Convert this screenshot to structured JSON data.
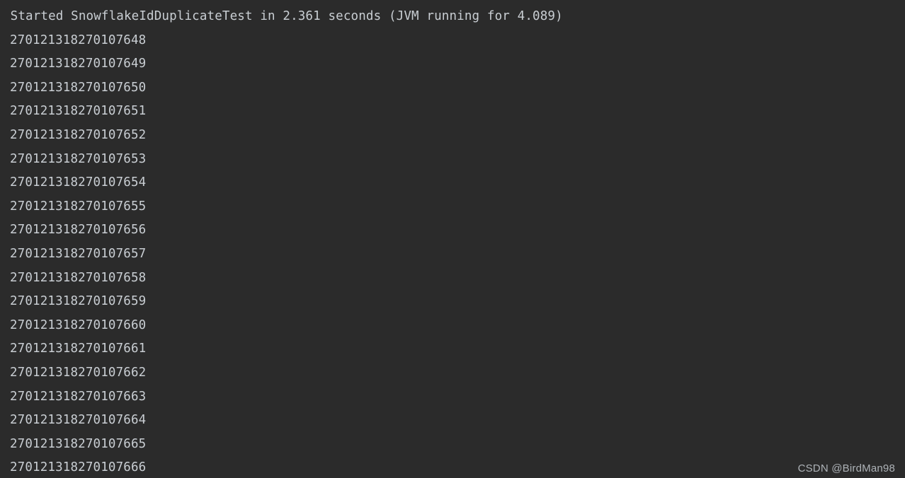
{
  "console": {
    "background_color": "#2b2b2b",
    "text_color": "#c9ced3",
    "header": {
      "text": " Started SnowflakeIdDuplicateTest in 2.361 seconds (JVM running for 4.089)",
      "application": "SnowflakeIdDuplicateTest",
      "startup_seconds": "2.361",
      "jvm_seconds": "4.089"
    },
    "lines": [
      "270121318270107648",
      "270121318270107649",
      "270121318270107650",
      "270121318270107651",
      "270121318270107652",
      "270121318270107653",
      "270121318270107654",
      "270121318270107655",
      "270121318270107656",
      "270121318270107657",
      "270121318270107658",
      "270121318270107659",
      "270121318270107660",
      "270121318270107661",
      "270121318270107662",
      "270121318270107663",
      "270121318270107664",
      "270121318270107665",
      "270121318270107666"
    ]
  },
  "watermark": {
    "text": "CSDN @BirdMan98",
    "color": "#b9bec3"
  }
}
